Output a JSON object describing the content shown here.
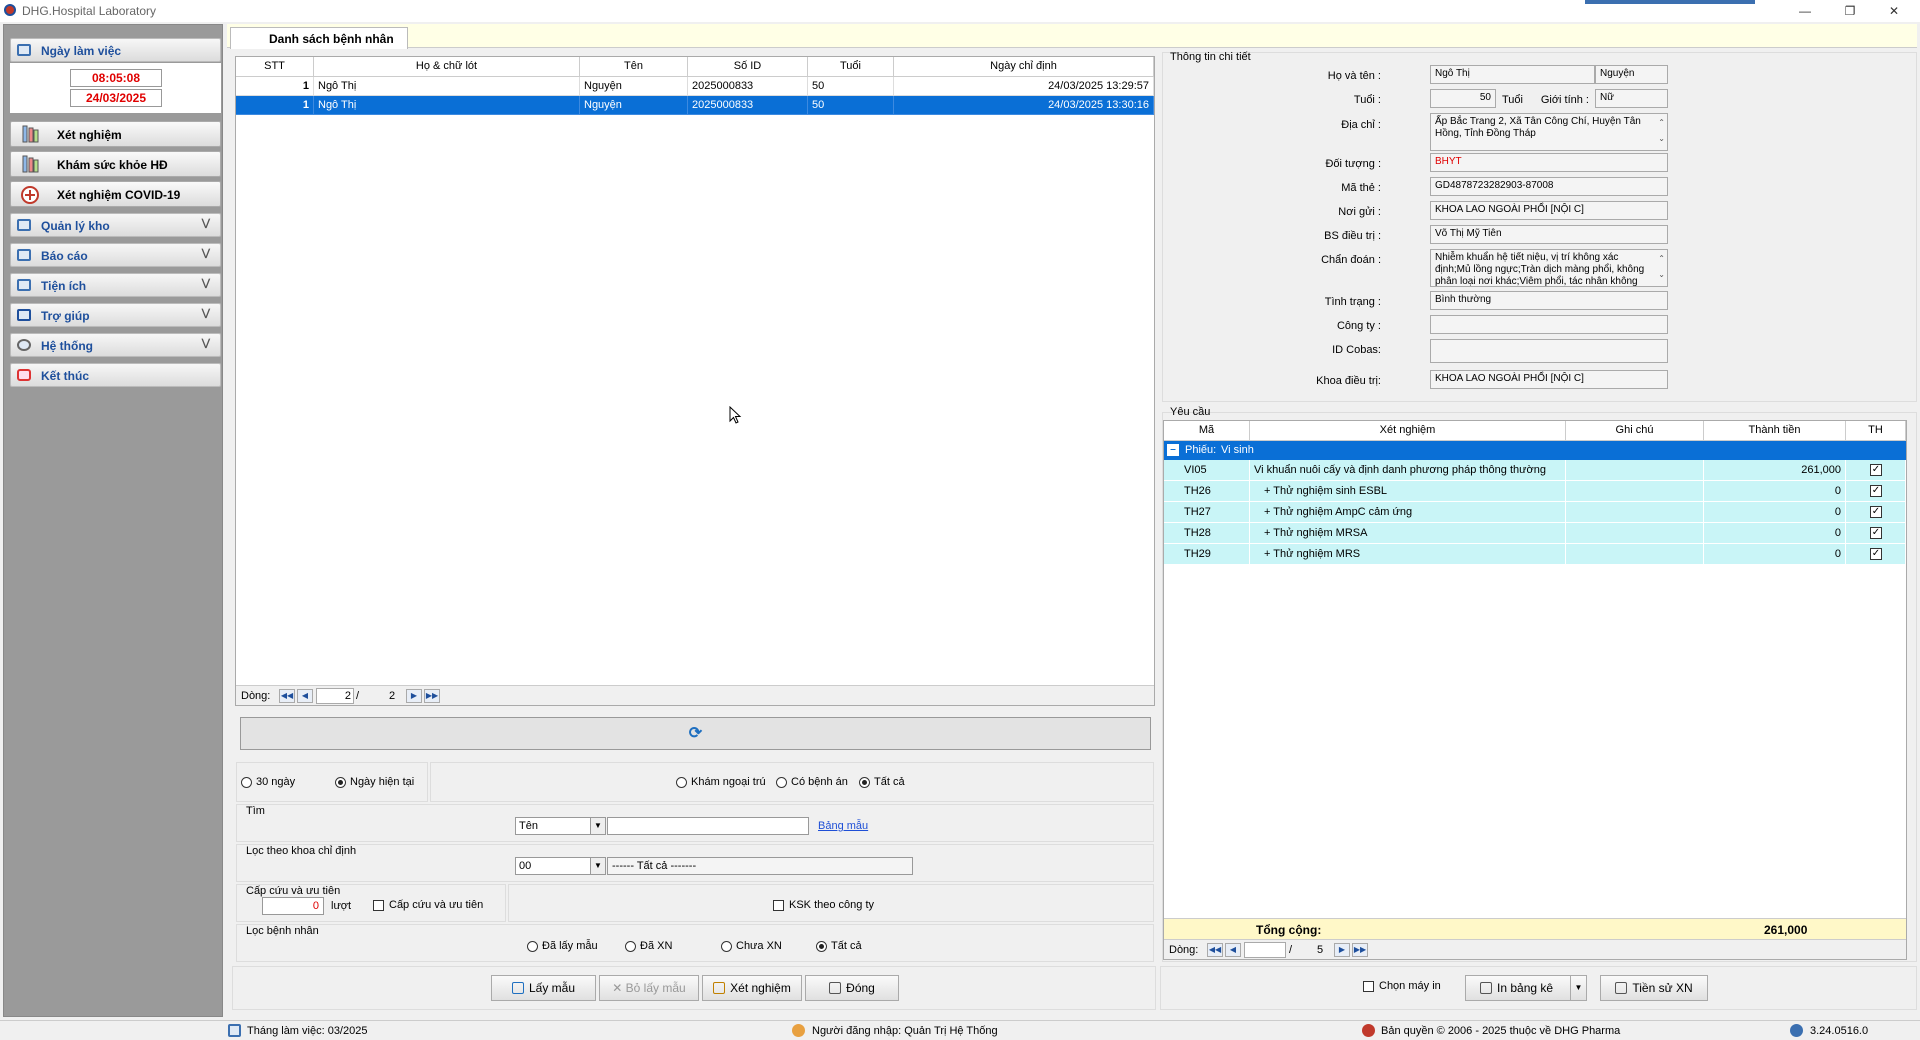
{
  "window": {
    "title": "DHG.Hospital Laboratory"
  },
  "sidebar": {
    "header_label": "Ngày làm việc",
    "time": "08:05:08",
    "date": "24/03/2025",
    "main_buttons": [
      "Xét nghiệm",
      "Khám sức khỏe HĐ",
      "Xét nghiệm COVID-19"
    ],
    "menus": [
      "Quản lý kho",
      "Báo cáo",
      "Tiện ích",
      "Trợ giúp",
      "Hệ thống"
    ],
    "exit_label": "Kết thúc"
  },
  "tab": {
    "label": "Danh sách bệnh nhân"
  },
  "patient_grid": {
    "columns": [
      "STT",
      "Họ & chữ lót",
      "Tên",
      "Số ID",
      "Tuổi",
      "Ngày chỉ định"
    ],
    "rows": [
      {
        "stt": "1",
        "ho": "Ngô Thị",
        "ten": "Nguyện",
        "soid": "2025000833",
        "tuoi": "50",
        "ngay": "24/03/2025 13:29:57"
      },
      {
        "stt": "1",
        "ho": "Ngô Thị",
        "ten": "Nguyện",
        "soid": "2025000833",
        "tuoi": "50",
        "ngay": "24/03/2025 13:30:16"
      }
    ],
    "selected_row": 1,
    "pager": {
      "label": "Dòng:",
      "current": "2",
      "sep": "/",
      "total": "2"
    }
  },
  "filters": {
    "range_30": "30 ngày",
    "range_today": "Ngày hiện tại",
    "type_outpatient": "Khám ngoại trú",
    "type_record": "Có bệnh án",
    "type_all": "Tất cả",
    "search_title": "Tìm",
    "search_field": "Tên",
    "search_value": "",
    "sample_table_link": "Bảng mẫu",
    "dept_title": "Lọc theo khoa chỉ định",
    "dept_code": "00",
    "dept_name": "------ Tất cả -------",
    "priority_title": "Cấp cứu và ưu tiên",
    "priority_count": "0",
    "priority_unit": "lượt",
    "priority_check": "Cấp cứu và ưu tiên",
    "ksk_check": "KSK theo công ty",
    "status_title": "Lọc bệnh nhân",
    "status_sampled": "Đã lấy mẫu",
    "status_tested": "Đã XN",
    "status_untested": "Chưa XN",
    "status_all": "Tất cả"
  },
  "actions": {
    "take_sample": "Lấy mẫu",
    "cancel_sample": "Bỏ lấy mẫu",
    "test": "Xét nghiệm",
    "close": "Đóng"
  },
  "detail": {
    "section_title": "Thông tin chi tiết",
    "labels": {
      "name": "Họ và tên :",
      "age": "Tuổi :",
      "age_unit": "Tuổi",
      "gender": "Giới tính :",
      "address": "Địa chỉ :",
      "subject": "Đối tượng :",
      "card": "Mã thẻ :",
      "sender": "Nơi gửi :",
      "doctor": "BS điều trị :",
      "diagnosis": "Chẩn đoán :",
      "condition": "Tình trạng :",
      "company": "Công ty :",
      "cobas": "ID Cobas:",
      "dept": "Khoa điều trị:"
    },
    "values": {
      "last_middle": "Ngô Thị",
      "first": "Nguyện",
      "age": "50",
      "gender": "Nữ",
      "address": "Ấp Bắc Trang 2, Xã Tân Công Chí, Huyện Tân Hồng, Tỉnh Đồng Tháp",
      "subject": "BHYT",
      "card": "GD4878723282903-87008",
      "sender": "KHOA LAO NGOÀI PHỔI [NỘI C]",
      "doctor": "Võ Thị Mỹ Tiên",
      "diagnosis": "Nhiễm khuẩn hệ tiết niệu, vị trí không xác định;Mủ lồng ngực;Tràn dịch màng phổi, không phân loại nơi khác;Viêm phổi, tác nhân không xác định;Lao phổi",
      "condition": "Bình thường",
      "company": "",
      "cobas": "",
      "dept": "KHOA LAO NGOÀI PHỔI [NỘI C]"
    },
    "subject_color": "#e00000"
  },
  "requests": {
    "section_title": "Yêu cầu",
    "columns": [
      "Mã",
      "Xét nghiệm",
      "Ghi chú",
      "Thành tiền",
      "TH"
    ],
    "group_label": "Phiếu:",
    "group_name": "Vi sinh",
    "rows": [
      {
        "code": "VI05",
        "name": "Vi khuẩn nuôi cấy và định danh phương pháp thông thường",
        "note": "",
        "price": "261,000",
        "th": true
      },
      {
        "code": "TH26",
        "name": "+ Thử nghiệm sinh ESBL",
        "note": "",
        "price": "0",
        "th": true
      },
      {
        "code": "TH27",
        "name": "+ Thử nghiệm AmpC cảm ứng",
        "note": "",
        "price": "0",
        "th": true
      },
      {
        "code": "TH28",
        "name": "+ Thử nghiệm MRSA",
        "note": "",
        "price": "0",
        "th": true
      },
      {
        "code": "TH29",
        "name": "+ Thử nghiệm MRS",
        "note": "",
        "price": "0",
        "th": true
      }
    ],
    "total_label": "Tổng cộng:",
    "total_value": "261,000",
    "pager": {
      "label": "Dòng:",
      "current": "",
      "sep": "/",
      "total": "5"
    },
    "row_color": "#c9f5f7",
    "group_color": "#0a6fd6"
  },
  "print": {
    "choose_printer": "Chọn máy in",
    "print_table": "In bảng kê",
    "history": "Tiền sử XN"
  },
  "status": {
    "month": "Tháng làm việc: 03/2025",
    "user": "Người đăng nhập: Quản Trị Hệ Thống",
    "copyright": "Bản quyền © 2006 - 2025 thuộc về DHG Pharma",
    "version": "3.24.0516.0"
  }
}
